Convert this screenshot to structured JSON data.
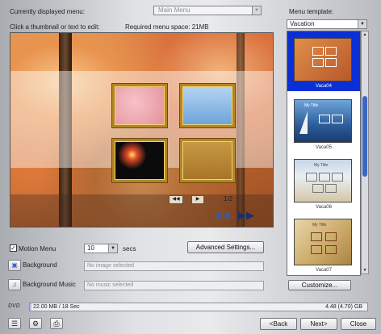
{
  "header": {
    "currently_displayed_label": "Currently displayed menu:",
    "menu_select_value": "Main Menu",
    "click_hint": "Click a thumbnail or text to edit:",
    "required_space": "Required menu space: 21MB"
  },
  "template_panel": {
    "label": "Menu template:",
    "selected_category": "Vacation",
    "items": [
      {
        "caption": "Vaca04",
        "selected": true,
        "title": ""
      },
      {
        "caption": "Vaca05",
        "selected": false,
        "title": "My Title"
      },
      {
        "caption": "Vaca06",
        "selected": false,
        "title": "My Title"
      },
      {
        "caption": "Vaca07",
        "selected": false,
        "title": "My Title"
      }
    ],
    "customize_label": "Customize..."
  },
  "preview": {
    "page_indicator": "1/2"
  },
  "options": {
    "motion_menu_label": "Motion Menu",
    "motion_menu_checked": true,
    "motion_seconds": "10",
    "secs_label": "secs",
    "advanced_label": "Advanced Settings...",
    "background_label": "Background",
    "background_value": "No image selected",
    "background_music_label": "Background Music",
    "background_music_value": "No music selected"
  },
  "status": {
    "disc_label": "DVD",
    "used": "22.00 MB / 18 Sec",
    "capacity": "4.48 (4.70) GB",
    "usage_fraction": 0.005
  },
  "nav": {
    "back_label": "<Back",
    "next_label": "Next>",
    "close_label": "Close"
  },
  "colors": {
    "selection_blue": "#0a2fd6",
    "thumb_frame": "#b38524"
  }
}
